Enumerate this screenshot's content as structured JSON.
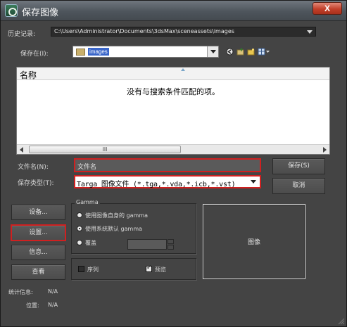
{
  "window": {
    "title": "保存图像",
    "close_label": "X"
  },
  "history": {
    "label": "历史记录:",
    "value": "C:\\Users\\Administrator\\Documents\\3dsMax\\sceneassets\\images"
  },
  "save_in": {
    "label": "保存在(I):",
    "value": "images"
  },
  "file_list": {
    "column_name": "名称",
    "empty_message": "没有与搜索条件匹配的项。",
    "scroll_grip": "III"
  },
  "file_name": {
    "label": "文件名(N):",
    "value": "文件名"
  },
  "file_type": {
    "label": "保存类型(T):",
    "value": "Targa 图像文件 (*.tga,*.vda,*.icb,*.vst)"
  },
  "buttons": {
    "save": "保存(S)",
    "cancel": "取消",
    "devices": "设备...",
    "setup": "设置...",
    "info": "信息...",
    "view": "查看"
  },
  "gamma": {
    "title": "Gamma",
    "own_gamma": "使用图像自身的 gamma",
    "system_default": "使用系统默认 gamma",
    "override": "覆盖",
    "selected": "system_default"
  },
  "options": {
    "sequence": "序列",
    "sequence_checked": false,
    "preview": "预览",
    "preview_checked": true
  },
  "preview_box": {
    "label": "图像"
  },
  "stats": {
    "label": "统计信息:",
    "value": "N/A"
  },
  "location": {
    "label": "位置:",
    "value": "N/A"
  },
  "colors": {
    "highlight_border": "#d02020",
    "selection": "#3a66c9"
  },
  "icons": [
    "back-icon",
    "up-folder-icon",
    "new-folder-icon",
    "view-menu-icon"
  ]
}
